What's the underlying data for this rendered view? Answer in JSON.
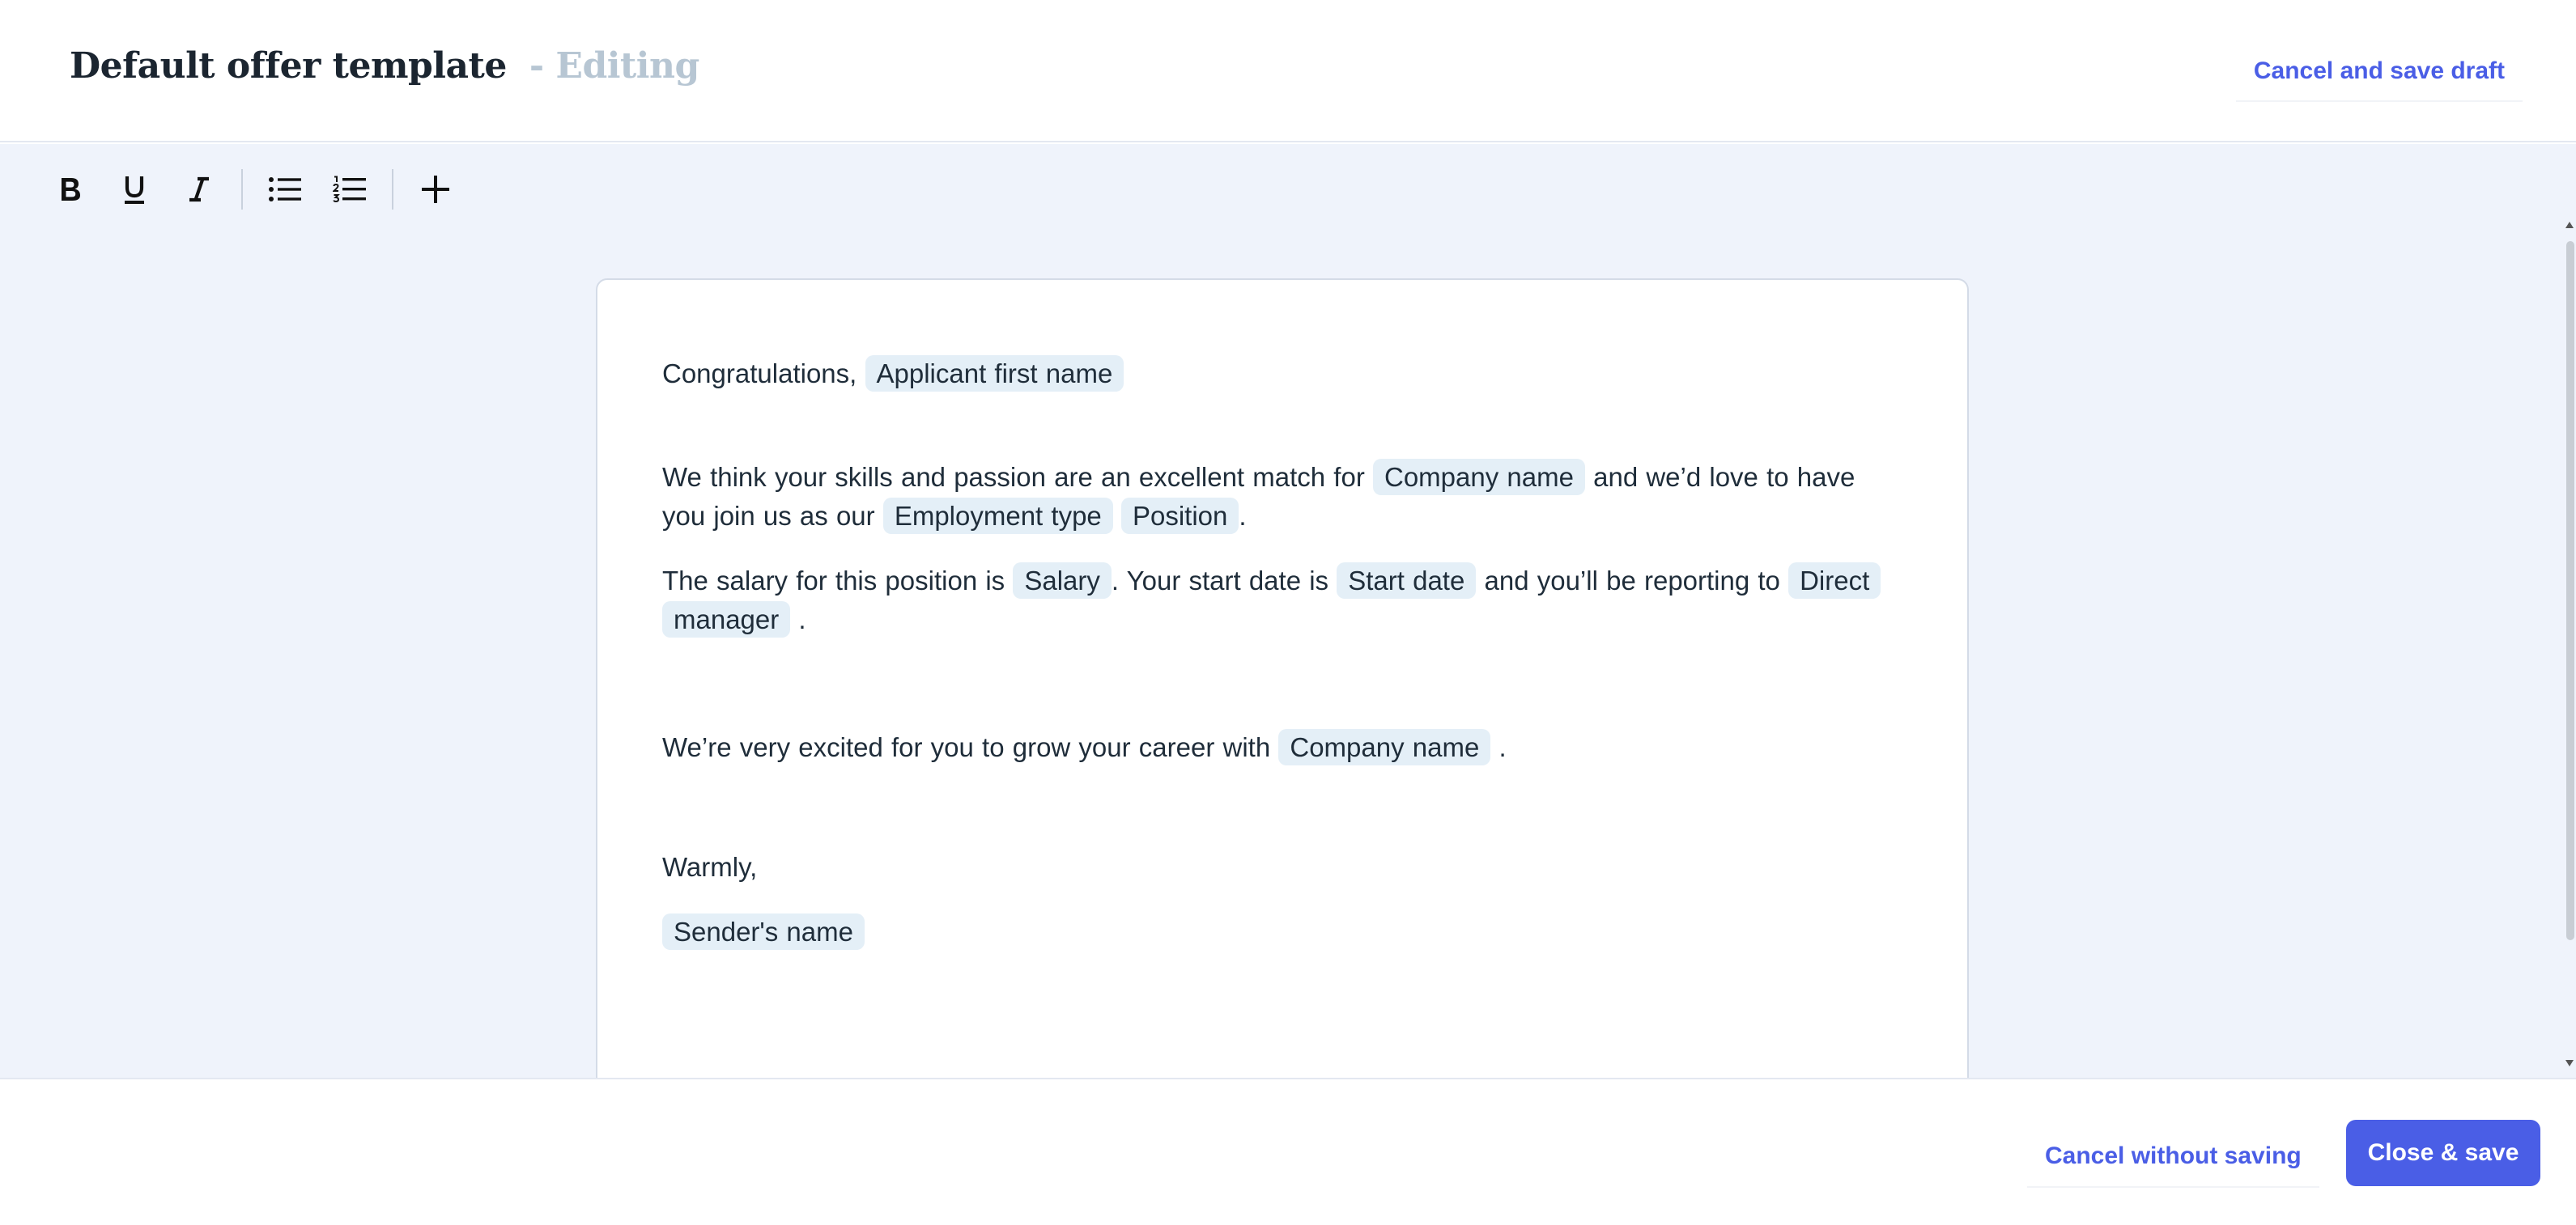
{
  "header": {
    "title": "Default offer template",
    "title_suffix": "- Editing",
    "cancel_draft_label": "Cancel and save draft"
  },
  "toolbar": {
    "buttons": [
      {
        "name": "bold",
        "icon": "bold-icon"
      },
      {
        "name": "underline",
        "icon": "underline-icon"
      },
      {
        "name": "italic",
        "icon": "italic-icon"
      },
      {
        "name": "bulleted-list",
        "icon": "bulleted-list-icon"
      },
      {
        "name": "numbered-list",
        "icon": "numbered-list-icon"
      },
      {
        "name": "insert",
        "icon": "plus-icon"
      }
    ]
  },
  "document": {
    "greeting": {
      "text": "Congratulations,",
      "tag": "Applicant first name"
    },
    "paragraph1": {
      "t1": "We think your skills and passion are an excellent match for",
      "tag1": "Company name",
      "t2": "and we’d love to have you join us as our",
      "tag2": "Employment type",
      "tag3": "Position",
      "t3": "."
    },
    "paragraph2": {
      "t1": "The salary for this position is",
      "tag1": "Salary",
      "t2": ". Your start date is",
      "tag2": "Start date",
      "t3": "and you’ll be reporting to",
      "tag3": "Direct manager",
      "t4": "."
    },
    "paragraph3": {
      "t1": "We’re very excited for you to grow your career with",
      "tag1": "Company name",
      "t2": "."
    },
    "closing": "Warmly,",
    "sender_tag": "Sender's name"
  },
  "footer": {
    "cancel_label": "Cancel without saving",
    "save_label": "Close & save"
  },
  "colors": {
    "accent": "#4a5ee6",
    "canvas_bg": "#eff3fb",
    "tag_bg": "#e4eff7",
    "title_suffix": "#b7c6d3"
  }
}
